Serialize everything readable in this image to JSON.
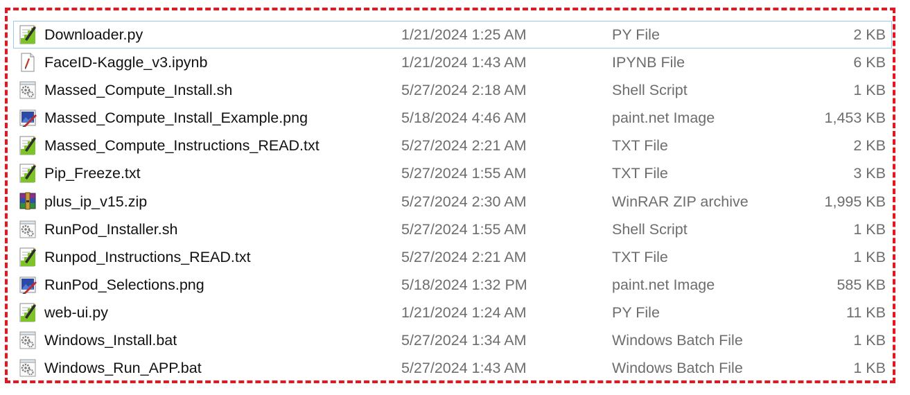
{
  "files": [
    {
      "name": "Downloader.py",
      "date": "1/21/2024 1:25 AM",
      "type": "PY File",
      "size": "2 KB",
      "icon": "py-file-icon",
      "selected": true
    },
    {
      "name": "FaceID-Kaggle_v3.ipynb",
      "date": "1/21/2024 1:43 AM",
      "type": "IPYNB File",
      "size": "6 KB",
      "icon": "ipynb-file-icon",
      "selected": false
    },
    {
      "name": "Massed_Compute_Install.sh",
      "date": "5/27/2024 2:18 AM",
      "type": "Shell Script",
      "size": "1 KB",
      "icon": "script-gear-icon",
      "selected": false
    },
    {
      "name": "Massed_Compute_Install_Example.png",
      "date": "5/18/2024 4:46 AM",
      "type": "paint.net Image",
      "size": "1,453 KB",
      "icon": "paintnet-image-icon",
      "selected": false
    },
    {
      "name": "Massed_Compute_Instructions_READ.txt",
      "date": "5/27/2024 2:21 AM",
      "type": "TXT File",
      "size": "2 KB",
      "icon": "text-file-icon",
      "selected": false
    },
    {
      "name": "Pip_Freeze.txt",
      "date": "5/27/2024 1:55 AM",
      "type": "TXT File",
      "size": "3 KB",
      "icon": "text-file-icon",
      "selected": false
    },
    {
      "name": "plus_ip_v15.zip",
      "date": "5/27/2024 2:30 AM",
      "type": "WinRAR ZIP archive",
      "size": "1,995 KB",
      "icon": "winrar-archive-icon",
      "selected": false
    },
    {
      "name": "RunPod_Installer.sh",
      "date": "5/27/2024 1:55 AM",
      "type": "Shell Script",
      "size": "1 KB",
      "icon": "script-gear-icon",
      "selected": false
    },
    {
      "name": "Runpod_Instructions_READ.txt",
      "date": "5/27/2024 2:21 AM",
      "type": "TXT File",
      "size": "1 KB",
      "icon": "text-file-icon",
      "selected": false
    },
    {
      "name": "RunPod_Selections.png",
      "date": "5/18/2024 1:32 PM",
      "type": "paint.net Image",
      "size": "585 KB",
      "icon": "paintnet-image-icon",
      "selected": false
    },
    {
      "name": "web-ui.py",
      "date": "1/21/2024 1:24 AM",
      "type": "PY File",
      "size": "11 KB",
      "icon": "py-file-icon",
      "selected": false
    },
    {
      "name": "Windows_Install.bat",
      "date": "5/27/2024 1:34 AM",
      "type": "Windows Batch File",
      "size": "1 KB",
      "icon": "batch-gear-icon",
      "selected": false
    },
    {
      "name": "Windows_Run_APP.bat",
      "date": "5/27/2024 1:43 AM",
      "type": "Windows Batch File",
      "size": "1 KB",
      "icon": "batch-gear-icon",
      "selected": false
    }
  ],
  "colors": {
    "highlight_border": "#e8141e",
    "selection_border": "#99c9ef",
    "name_text": "#111111",
    "detail_text": "#6d6d6d"
  }
}
